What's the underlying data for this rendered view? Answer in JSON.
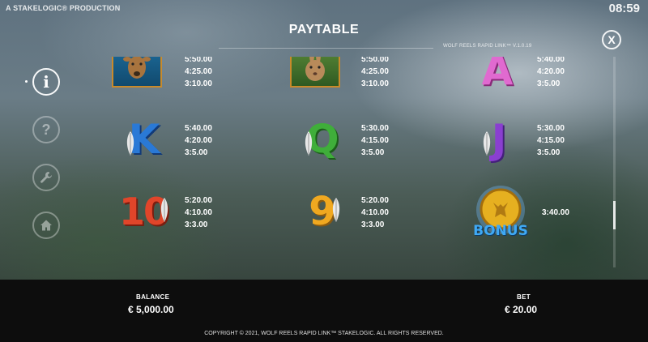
{
  "header": {
    "brand": "A STAKELOGIC® PRODUCTION",
    "clock": "08:59",
    "title": "PAYTABLE",
    "version": "WOLF REELS RAPID LINK™ V.1.0.19",
    "close_label": "X"
  },
  "menu": {
    "items": [
      {
        "name": "info",
        "icon": "info-icon",
        "glyph": "i"
      },
      {
        "name": "help",
        "icon": "help-icon",
        "glyph": "?"
      },
      {
        "name": "settings",
        "icon": "wrench-icon",
        "glyph": "🔧"
      },
      {
        "name": "home",
        "icon": "home-icon",
        "glyph": "⌂"
      }
    ]
  },
  "paytable": {
    "rows": [
      [
        {
          "symbol": "deer",
          "pays": [
            "5:50.00",
            "4:25.00",
            "3:10.00"
          ]
        },
        {
          "symbol": "rabbit",
          "pays": [
            "5:50.00",
            "4:25.00",
            "3:10.00"
          ]
        },
        {
          "symbol": "A",
          "pays": [
            "5:40.00",
            "4:20.00",
            "3:5.00"
          ]
        }
      ],
      [
        {
          "symbol": "K",
          "pays": [
            "5:40.00",
            "4:20.00",
            "3:5.00"
          ]
        },
        {
          "symbol": "Q",
          "pays": [
            "5:30.00",
            "4:15.00",
            "3:5.00"
          ]
        },
        {
          "symbol": "J",
          "pays": [
            "5:30.00",
            "4:15.00",
            "3:5.00"
          ]
        }
      ],
      [
        {
          "symbol": "10",
          "pays": [
            "5:20.00",
            "4:10.00",
            "3:3.00"
          ]
        },
        {
          "symbol": "9",
          "pays": [
            "5:20.00",
            "4:10.00",
            "3:3.00"
          ]
        },
        {
          "symbol": "BONUS",
          "pays": [
            "3:40.00"
          ]
        }
      ]
    ],
    "scroll_position": 0.8
  },
  "footer": {
    "balance_label": "BALANCE",
    "balance_value": "€ 5,000.00",
    "bet_label": "BET",
    "bet_value": "€ 20.00",
    "copyright": "COPYRIGHT © 2021, WOLF REELS RAPID LINK™ STAKELOGIC. ALL RIGHTS RESERVED."
  },
  "colors": {
    "letter_k": "#2a79d6",
    "letter_q": "#3fae3a",
    "letter_j": "#8a3fd0",
    "letter_a": "#e06ad0",
    "letter_10": "#e1452a",
    "letter_9": "#f0a820",
    "bonus_coin": "#e6b020",
    "bonus_text": "#3fa9f5"
  }
}
